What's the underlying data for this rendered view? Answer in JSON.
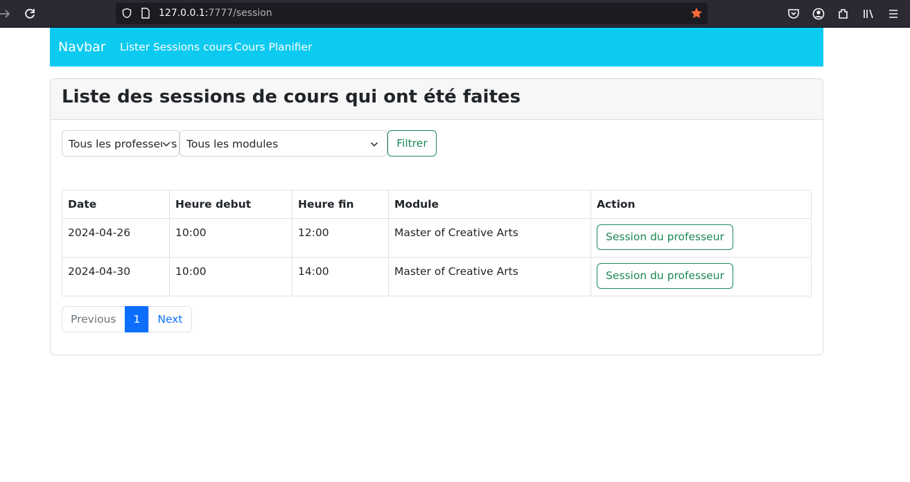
{
  "browser": {
    "url_host": "127.0.0.1:",
    "url_path": "7777/session"
  },
  "navbar": {
    "brand": "Navbar",
    "links": [
      "Lister Sessions cours",
      "Cours Planifier"
    ]
  },
  "page": {
    "title": "Liste des sessions de cours qui ont été faites"
  },
  "filters": {
    "professor_select": "Tous les professeurs",
    "module_select": "Tous les modules",
    "filter_button": "Filtrer"
  },
  "table": {
    "headers": [
      "Date",
      "Heure debut",
      "Heure fin",
      "Module",
      "Action"
    ],
    "rows": [
      {
        "date": "2024-04-26",
        "start": "10:00",
        "end": "12:00",
        "module": "Master of Creative Arts",
        "action": "Session du professeur"
      },
      {
        "date": "2024-04-30",
        "start": "10:00",
        "end": "14:00",
        "module": "Master of Creative Arts",
        "action": "Session du professeur"
      }
    ]
  },
  "pagination": {
    "previous": "Previous",
    "current": "1",
    "next": "Next"
  },
  "colors": {
    "navbar_bg": "#0dcaf0",
    "success": "#198754",
    "primary": "#0d6efd"
  },
  "icons": [
    "back-icon",
    "reload-icon",
    "shield-icon",
    "page-icon",
    "bookmark-star-icon",
    "pocket-icon",
    "account-icon",
    "extensions-icon",
    "library-icon",
    "menu-icon",
    "chevron-down-icon"
  ]
}
